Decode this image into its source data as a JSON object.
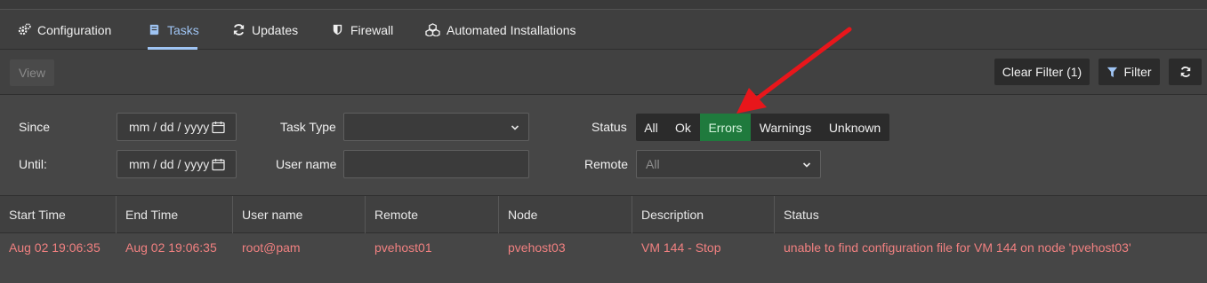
{
  "tabs": [
    {
      "label": "Configuration",
      "icon": "gears-icon"
    },
    {
      "label": "Tasks",
      "icon": "book-icon",
      "active": true
    },
    {
      "label": "Updates",
      "icon": "refresh-icon"
    },
    {
      "label": "Firewall",
      "icon": "shield-icon"
    },
    {
      "label": "Automated Installations",
      "icon": "cubes-icon"
    }
  ],
  "toolbar": {
    "view_label": "View",
    "clear_filter_label": "Clear Filter (1)",
    "filter_label": "Filter"
  },
  "filters": {
    "since_label": "Since",
    "until_label": "Until:",
    "since_placeholder": "mm / dd / yyyy",
    "until_placeholder": "mm / dd / yyyy",
    "task_type_label": "Task Type",
    "task_type_value": "",
    "user_name_label": "User name",
    "user_name_value": "",
    "status_label": "Status",
    "status_options": [
      "All",
      "Ok",
      "Errors",
      "Warnings",
      "Unknown"
    ],
    "status_selected": "Errors",
    "remote_label": "Remote",
    "remote_value": "All"
  },
  "table": {
    "columns": [
      "Start Time",
      "End Time",
      "User name",
      "Remote",
      "Node",
      "Description",
      "Status"
    ],
    "rows": [
      [
        "Aug 02 19:06:35",
        "Aug 02 19:06:35",
        "root@pam",
        "pvehost01",
        "pvehost03",
        "VM 144 - Stop",
        "unable to find configuration file for VM 144 on node 'pvehost03'"
      ]
    ]
  },
  "colors": {
    "error_text": "#f08080",
    "active_tab": "#9fc4f3",
    "errors_selected_bg": "#1f7a3d",
    "annotation_arrow": "#e8161b"
  }
}
